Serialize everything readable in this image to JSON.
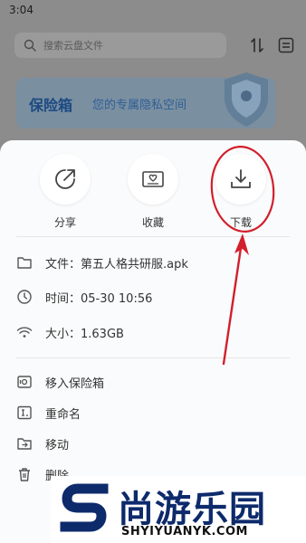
{
  "status_bar": {
    "time": "3:04"
  },
  "search": {
    "placeholder": "搜索云盘文件"
  },
  "vault_banner": {
    "title": "保险箱",
    "subtitle": "您的专属隐私空间"
  },
  "sheet": {
    "actions": [
      {
        "label": "分享",
        "icon": "share-icon"
      },
      {
        "label": "收藏",
        "icon": "favorite-icon"
      },
      {
        "label": "下载",
        "icon": "download-icon"
      }
    ],
    "info": {
      "file": "文件：第五人格共研服.apk",
      "time": "时间：05-30 10:56",
      "size": "大小：1.63GB"
    },
    "operations": [
      {
        "label": "移入保险箱",
        "icon": "vault-icon"
      },
      {
        "label": "重命名",
        "icon": "rename-icon"
      },
      {
        "label": "移动",
        "icon": "move-folder-icon"
      },
      {
        "label": "删除",
        "icon": "trash-icon"
      }
    ]
  },
  "annotation": {
    "color": "#d21f2b"
  },
  "watermark": {
    "chinese": "尚游乐园",
    "english": "SHYIYUANYK.COM"
  }
}
